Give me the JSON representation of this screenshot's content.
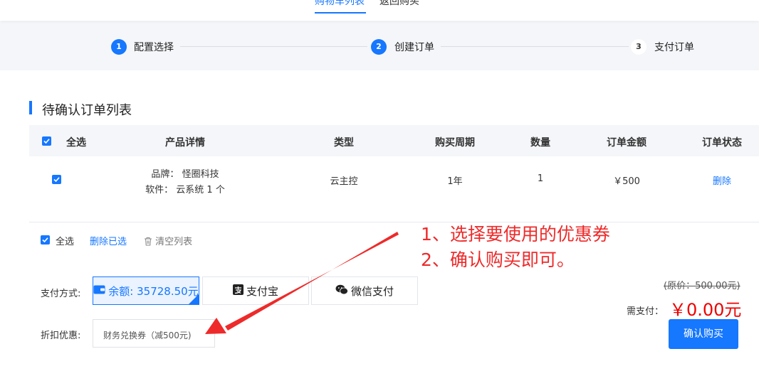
{
  "nav": {
    "tab_cart": "购物车列表",
    "tab_back": "返回购买"
  },
  "steps": [
    {
      "num": "1",
      "label": "配置选择",
      "active": true
    },
    {
      "num": "2",
      "label": "创建订单",
      "active": true
    },
    {
      "num": "3",
      "label": "支付订单",
      "active": false
    }
  ],
  "section_title": "待确认订单列表",
  "table": {
    "headers": {
      "select_all": "全选",
      "product": "产品详情",
      "type": "类型",
      "period": "购买周期",
      "qty": "数量",
      "amount": "订单金额",
      "status": "订单状态"
    },
    "rows": [
      {
        "brand_label": "品牌：",
        "brand": "怪圈科技",
        "software_label": "软件：",
        "software": "云系统 1 个",
        "type": "云主控",
        "period": "1年",
        "qty": "1",
        "amount": "￥500",
        "action": "删除"
      }
    ]
  },
  "actions": {
    "select_all": "全选",
    "delete_selected": "删除已选",
    "clear_list": "清空列表"
  },
  "payment": {
    "label": "支付方式:",
    "options": [
      {
        "label": "余额: 35728.50元",
        "icon": "wallet-icon",
        "selected": true
      },
      {
        "label": "支付宝",
        "icon": "alipay-icon",
        "selected": false
      },
      {
        "label": "微信支付",
        "icon": "wechat-icon",
        "selected": false
      }
    ]
  },
  "discount": {
    "label": "折扣优惠:",
    "value": "财务兑换券（减500元)"
  },
  "summary": {
    "original": "(原价：500.00元)",
    "need_label": "需支付：",
    "amount": "￥0.00元",
    "confirm": "确认购买"
  },
  "annotation": {
    "line1": "1、选择要使用的优惠券",
    "line2": "2、确认购买即可。"
  },
  "colors": {
    "primary": "#1677ff",
    "annotation": "#ee2a2a",
    "price": "#e00000"
  }
}
